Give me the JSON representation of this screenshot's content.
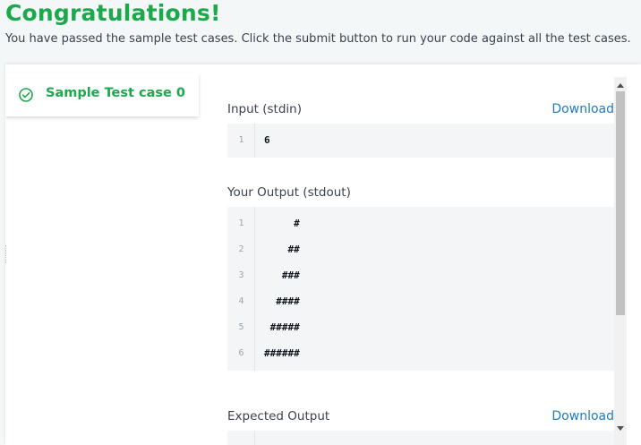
{
  "banner": {
    "title": "Congratulations!",
    "message": "You have passed the sample test cases. Click the submit button to run your code against all the test cases."
  },
  "tabs": [
    {
      "label": "Sample Test case 0",
      "icon": "check-circle-icon",
      "status": "passed"
    }
  ],
  "sections": {
    "input": {
      "title": "Input (stdin)",
      "download_label": "Download",
      "lines": [
        {
          "num": "1",
          "text": "6"
        }
      ]
    },
    "your_output": {
      "title": "Your Output (stdout)",
      "lines": [
        {
          "num": "1",
          "text": "     #"
        },
        {
          "num": "2",
          "text": "    ##"
        },
        {
          "num": "3",
          "text": "   ###"
        },
        {
          "num": "4",
          "text": "  ####"
        },
        {
          "num": "5",
          "text": " #####"
        },
        {
          "num": "6",
          "text": "######"
        }
      ]
    },
    "expected_output": {
      "title": "Expected Output",
      "download_label": "Download"
    }
  },
  "colors": {
    "success": "#1ba94c",
    "link": "#1f7dbf",
    "text": "#39424e",
    "code_bg": "#f3f5f6",
    "page_bg": "#f3f7f7"
  }
}
